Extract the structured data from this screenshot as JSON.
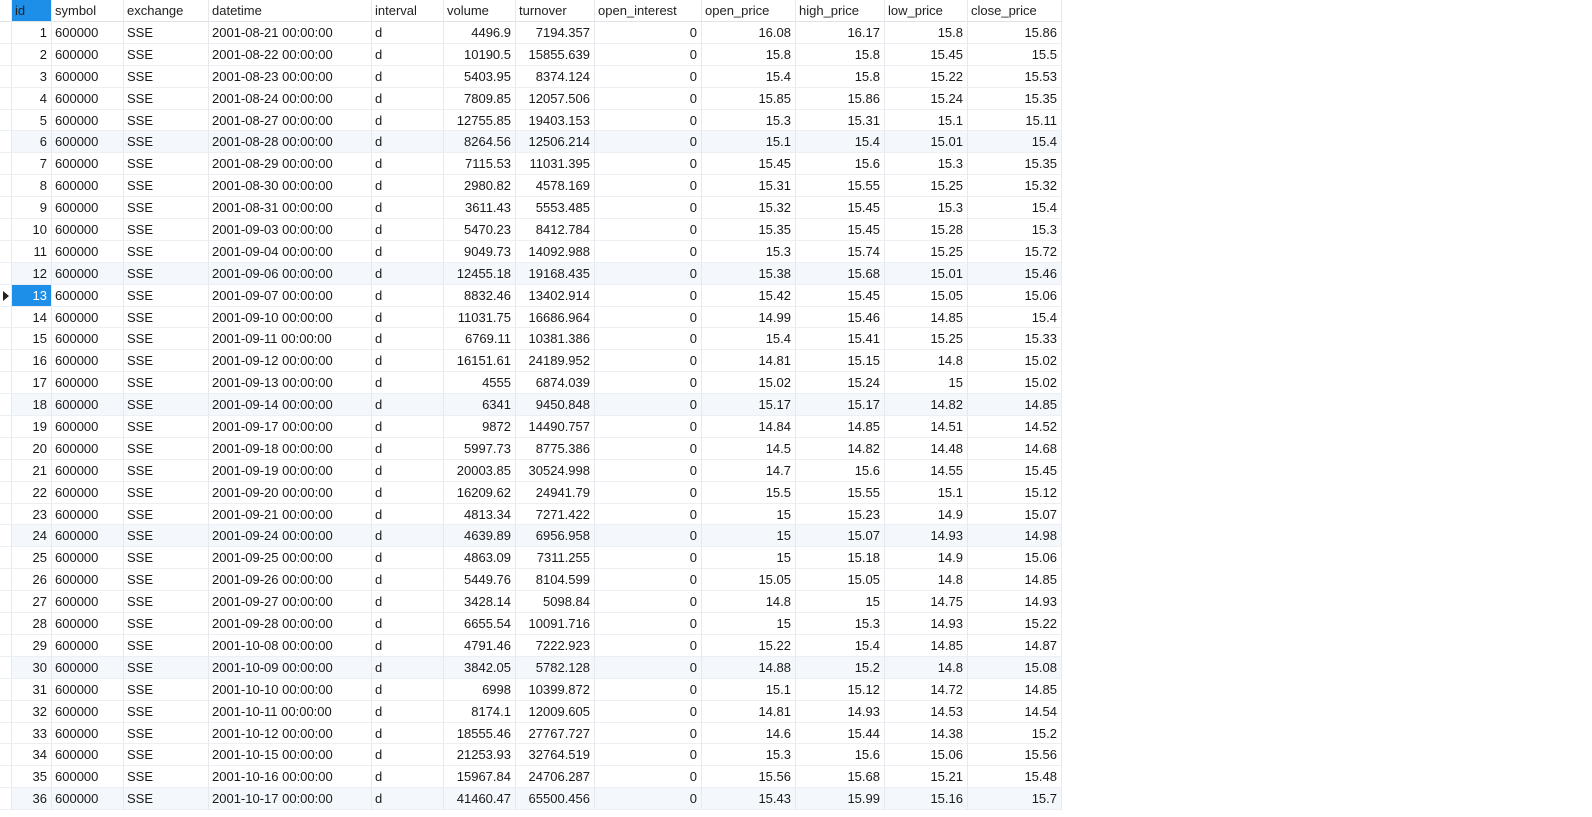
{
  "columns": [
    "id",
    "symbol",
    "exchange",
    "datetime",
    "interval",
    "volume",
    "turnover",
    "open_interest",
    "open_price",
    "high_price",
    "low_price",
    "close_price"
  ],
  "selected_row_index": 12,
  "rows": [
    [
      "1",
      "600000",
      "SSE",
      "2001-08-21 00:00:00",
      "d",
      "4496.9",
      "7194.357",
      "0",
      "16.08",
      "16.17",
      "15.8",
      "15.86"
    ],
    [
      "2",
      "600000",
      "SSE",
      "2001-08-22 00:00:00",
      "d",
      "10190.5",
      "15855.639",
      "0",
      "15.8",
      "15.8",
      "15.45",
      "15.5"
    ],
    [
      "3",
      "600000",
      "SSE",
      "2001-08-23 00:00:00",
      "d",
      "5403.95",
      "8374.124",
      "0",
      "15.4",
      "15.8",
      "15.22",
      "15.53"
    ],
    [
      "4",
      "600000",
      "SSE",
      "2001-08-24 00:00:00",
      "d",
      "7809.85",
      "12057.506",
      "0",
      "15.85",
      "15.86",
      "15.24",
      "15.35"
    ],
    [
      "5",
      "600000",
      "SSE",
      "2001-08-27 00:00:00",
      "d",
      "12755.85",
      "19403.153",
      "0",
      "15.3",
      "15.31",
      "15.1",
      "15.11"
    ],
    [
      "6",
      "600000",
      "SSE",
      "2001-08-28 00:00:00",
      "d",
      "8264.56",
      "12506.214",
      "0",
      "15.1",
      "15.4",
      "15.01",
      "15.4"
    ],
    [
      "7",
      "600000",
      "SSE",
      "2001-08-29 00:00:00",
      "d",
      "7115.53",
      "11031.395",
      "0",
      "15.45",
      "15.6",
      "15.3",
      "15.35"
    ],
    [
      "8",
      "600000",
      "SSE",
      "2001-08-30 00:00:00",
      "d",
      "2980.82",
      "4578.169",
      "0",
      "15.31",
      "15.55",
      "15.25",
      "15.32"
    ],
    [
      "9",
      "600000",
      "SSE",
      "2001-08-31 00:00:00",
      "d",
      "3611.43",
      "5553.485",
      "0",
      "15.32",
      "15.45",
      "15.3",
      "15.4"
    ],
    [
      "10",
      "600000",
      "SSE",
      "2001-09-03 00:00:00",
      "d",
      "5470.23",
      "8412.784",
      "0",
      "15.35",
      "15.45",
      "15.28",
      "15.3"
    ],
    [
      "11",
      "600000",
      "SSE",
      "2001-09-04 00:00:00",
      "d",
      "9049.73",
      "14092.988",
      "0",
      "15.3",
      "15.74",
      "15.25",
      "15.72"
    ],
    [
      "12",
      "600000",
      "SSE",
      "2001-09-06 00:00:00",
      "d",
      "12455.18",
      "19168.435",
      "0",
      "15.38",
      "15.68",
      "15.01",
      "15.46"
    ],
    [
      "13",
      "600000",
      "SSE",
      "2001-09-07 00:00:00",
      "d",
      "8832.46",
      "13402.914",
      "0",
      "15.42",
      "15.45",
      "15.05",
      "15.06"
    ],
    [
      "14",
      "600000",
      "SSE",
      "2001-09-10 00:00:00",
      "d",
      "11031.75",
      "16686.964",
      "0",
      "14.99",
      "15.46",
      "14.85",
      "15.4"
    ],
    [
      "15",
      "600000",
      "SSE",
      "2001-09-11 00:00:00",
      "d",
      "6769.11",
      "10381.386",
      "0",
      "15.4",
      "15.41",
      "15.25",
      "15.33"
    ],
    [
      "16",
      "600000",
      "SSE",
      "2001-09-12 00:00:00",
      "d",
      "16151.61",
      "24189.952",
      "0",
      "14.81",
      "15.15",
      "14.8",
      "15.02"
    ],
    [
      "17",
      "600000",
      "SSE",
      "2001-09-13 00:00:00",
      "d",
      "4555",
      "6874.039",
      "0",
      "15.02",
      "15.24",
      "15",
      "15.02"
    ],
    [
      "18",
      "600000",
      "SSE",
      "2001-09-14 00:00:00",
      "d",
      "6341",
      "9450.848",
      "0",
      "15.17",
      "15.17",
      "14.82",
      "14.85"
    ],
    [
      "19",
      "600000",
      "SSE",
      "2001-09-17 00:00:00",
      "d",
      "9872",
      "14490.757",
      "0",
      "14.84",
      "14.85",
      "14.51",
      "14.52"
    ],
    [
      "20",
      "600000",
      "SSE",
      "2001-09-18 00:00:00",
      "d",
      "5997.73",
      "8775.386",
      "0",
      "14.5",
      "14.82",
      "14.48",
      "14.68"
    ],
    [
      "21",
      "600000",
      "SSE",
      "2001-09-19 00:00:00",
      "d",
      "20003.85",
      "30524.998",
      "0",
      "14.7",
      "15.6",
      "14.55",
      "15.45"
    ],
    [
      "22",
      "600000",
      "SSE",
      "2001-09-20 00:00:00",
      "d",
      "16209.62",
      "24941.79",
      "0",
      "15.5",
      "15.55",
      "15.1",
      "15.12"
    ],
    [
      "23",
      "600000",
      "SSE",
      "2001-09-21 00:00:00",
      "d",
      "4813.34",
      "7271.422",
      "0",
      "15",
      "15.23",
      "14.9",
      "15.07"
    ],
    [
      "24",
      "600000",
      "SSE",
      "2001-09-24 00:00:00",
      "d",
      "4639.89",
      "6956.958",
      "0",
      "15",
      "15.07",
      "14.93",
      "14.98"
    ],
    [
      "25",
      "600000",
      "SSE",
      "2001-09-25 00:00:00",
      "d",
      "4863.09",
      "7311.255",
      "0",
      "15",
      "15.18",
      "14.9",
      "15.06"
    ],
    [
      "26",
      "600000",
      "SSE",
      "2001-09-26 00:00:00",
      "d",
      "5449.76",
      "8104.599",
      "0",
      "15.05",
      "15.05",
      "14.8",
      "14.85"
    ],
    [
      "27",
      "600000",
      "SSE",
      "2001-09-27 00:00:00",
      "d",
      "3428.14",
      "5098.84",
      "0",
      "14.8",
      "15",
      "14.75",
      "14.93"
    ],
    [
      "28",
      "600000",
      "SSE",
      "2001-09-28 00:00:00",
      "d",
      "6655.54",
      "10091.716",
      "0",
      "15",
      "15.3",
      "14.93",
      "15.22"
    ],
    [
      "29",
      "600000",
      "SSE",
      "2001-10-08 00:00:00",
      "d",
      "4791.46",
      "7222.923",
      "0",
      "15.22",
      "15.4",
      "14.85",
      "14.87"
    ],
    [
      "30",
      "600000",
      "SSE",
      "2001-10-09 00:00:00",
      "d",
      "3842.05",
      "5782.128",
      "0",
      "14.88",
      "15.2",
      "14.8",
      "15.08"
    ],
    [
      "31",
      "600000",
      "SSE",
      "2001-10-10 00:00:00",
      "d",
      "6998",
      "10399.872",
      "0",
      "15.1",
      "15.12",
      "14.72",
      "14.85"
    ],
    [
      "32",
      "600000",
      "SSE",
      "2001-10-11 00:00:00",
      "d",
      "8174.1",
      "12009.605",
      "0",
      "14.81",
      "14.93",
      "14.53",
      "14.54"
    ],
    [
      "33",
      "600000",
      "SSE",
      "2001-10-12 00:00:00",
      "d",
      "18555.46",
      "27767.727",
      "0",
      "14.6",
      "15.44",
      "14.38",
      "15.2"
    ],
    [
      "34",
      "600000",
      "SSE",
      "2001-10-15 00:00:00",
      "d",
      "21253.93",
      "32764.519",
      "0",
      "15.3",
      "15.6",
      "15.06",
      "15.56"
    ],
    [
      "35",
      "600000",
      "SSE",
      "2001-10-16 00:00:00",
      "d",
      "15967.84",
      "24706.287",
      "0",
      "15.56",
      "15.68",
      "15.21",
      "15.48"
    ],
    [
      "36",
      "600000",
      "SSE",
      "2001-10-17 00:00:00",
      "d",
      "41460.47",
      "65500.456",
      "0",
      "15.43",
      "15.99",
      "15.16",
      "15.7"
    ]
  ]
}
